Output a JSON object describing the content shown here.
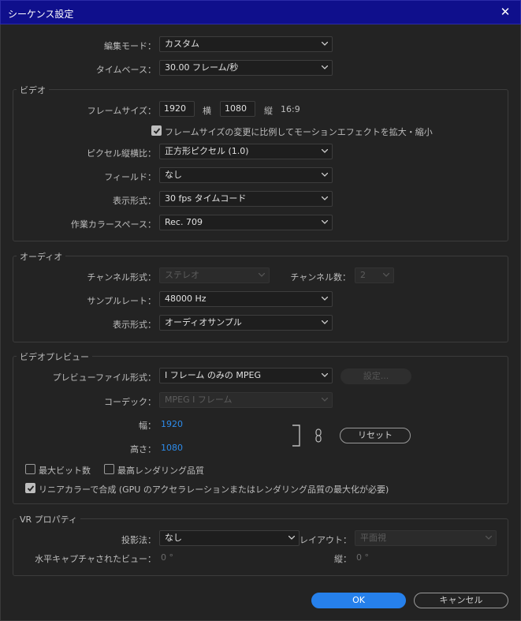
{
  "window": {
    "title": "シーケンス設定",
    "close_glyph": "✕"
  },
  "general": {
    "edit_mode_label": "編集モード：",
    "edit_mode_value": "カスタム",
    "timebase_label": "タイムベース：",
    "timebase_value": "30.00  フレーム/秒"
  },
  "video": {
    "group_title": "ビデオ",
    "frame_size_label": "フレームサイズ：",
    "width": "1920",
    "width_unit": "横",
    "height": "1080",
    "height_unit": "縦",
    "aspect": "16:9",
    "scale_checkbox_label": "フレームサイズの変更に比例してモーションエフェクトを拡大・縮小",
    "pixel_aspect_label": "ピクセル縦横比：",
    "pixel_aspect_value": "正方形ピクセル (1.0)",
    "fields_label": "フィールド：",
    "fields_value": "なし",
    "display_format_label": "表示形式：",
    "display_format_value": "30  fps タイムコード",
    "color_space_label": "作業カラースペース：",
    "color_space_value": "Rec. 709"
  },
  "audio": {
    "group_title": "オーディオ",
    "channel_format_label": "チャンネル形式：",
    "channel_format_value": "ステレオ",
    "channel_count_label": "チャンネル数：",
    "channel_count_value": "2",
    "sample_rate_label": "サンプルレート：",
    "sample_rate_value": "48000 Hz",
    "display_format_label": "表示形式：",
    "display_format_value": "オーディオサンプル"
  },
  "preview": {
    "group_title": "ビデオプレビュー",
    "file_format_label": "プレビューファイル形式：",
    "file_format_value": "I フレーム のみの MPEG",
    "settings_button": "設定...",
    "codec_label": "コーデック：",
    "codec_value": "MPEG I フレーム",
    "width_label": "幅：",
    "width_value": "1920",
    "height_label": "高さ：",
    "height_value": "1080",
    "reset_button": "リセット",
    "max_bit_depth": "最大ビット数",
    "max_render_quality": "最高レンダリング品質",
    "linear_color": "リニアカラーで合成 (GPU のアクセラレーションまたはレンダリング品質の最大化が必要)"
  },
  "vr": {
    "group_title": "VR プロパティ",
    "projection_label": "投影法：",
    "projection_value": "なし",
    "layout_label": "レイアウト：",
    "layout_value": "平面視",
    "h_capture_label": "水平キャプチャされたビュー：",
    "h_capture_value": "0 °",
    "vertical_label": "縦：",
    "vertical_value": "0 °"
  },
  "footer": {
    "ok": "OK",
    "cancel": "キャンセル"
  },
  "colors": {
    "title_bar": "#0f0f8c",
    "accent": "#2680eb",
    "link": "#2d8ceb",
    "background": "#232323"
  }
}
